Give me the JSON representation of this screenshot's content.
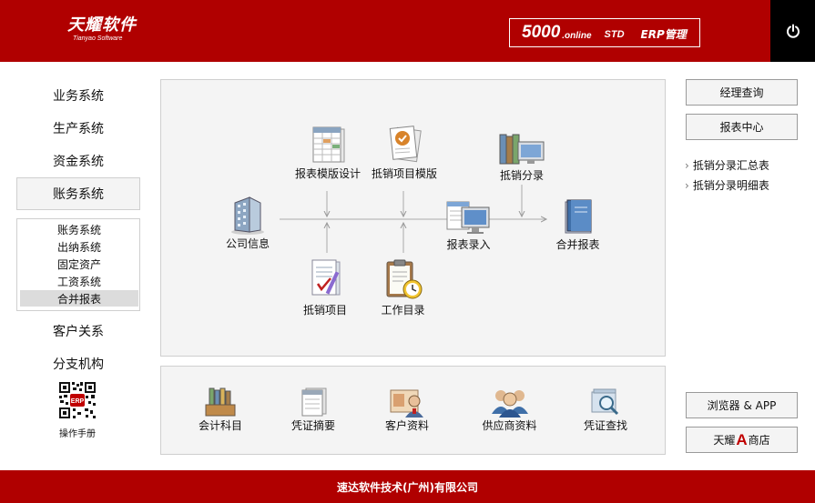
{
  "header": {
    "brand_cn": "天耀软件",
    "brand_en": "Tianyao Software",
    "product_number": "5000",
    "product_online": ".online",
    "product_edition": "STD",
    "product_name": "ERP管理",
    "power_icon": "power-icon"
  },
  "left_nav": {
    "items": [
      "业务系统",
      "生产系统",
      "资金系统",
      "账务系统",
      "客户关系",
      "分支机构"
    ],
    "active": "账务系统",
    "sub_items": [
      "账务系统",
      "出纳系统",
      "固定资产",
      "工资系统",
      "合并报表"
    ],
    "sub_selected": "合并报表",
    "qr_label": "操作手册",
    "qr_badge": "ERP"
  },
  "flow": {
    "nodes": {
      "report_template": "报表模版设计",
      "expense_template": "抵销项目模版",
      "offset_entry": "抵销分录",
      "company_info": "公司信息",
      "report_entry": "报表录入",
      "consolidated_report": "合并报表",
      "expense_items": "抵销项目",
      "work_directory": "工作目录"
    }
  },
  "bottom": {
    "items": [
      "会计科目",
      "凭证摘要",
      "客户资料",
      "供应商资料",
      "凭证查找"
    ]
  },
  "right": {
    "manager_query": "经理查询",
    "report_center": "报表中心",
    "links": [
      "抵销分录汇总表",
      "抵销分录明细表"
    ],
    "browser_app": "浏览器 & APP",
    "store_prefix": "天耀",
    "store_a": "A",
    "store_suffix": "商店"
  },
  "footer": {
    "company": "速达软件技术(广州)有限公司"
  },
  "colors": {
    "brand_red": "#b00000",
    "panel_bg": "#f4f4f4",
    "panel_border": "#cfcfcf"
  }
}
